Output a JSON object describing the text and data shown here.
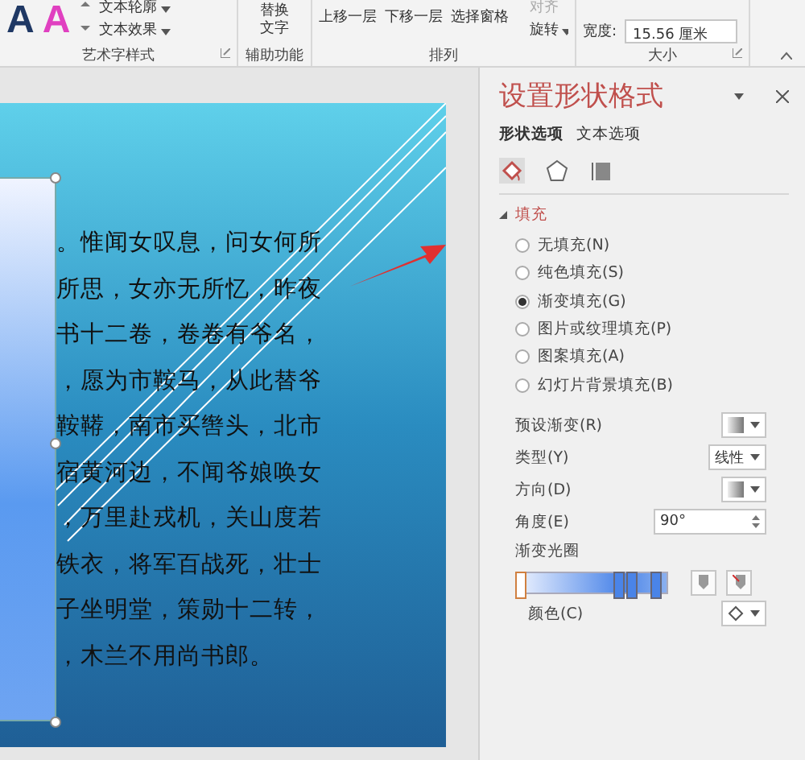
{
  "ribbon": {
    "wordart_samples": [
      {
        "glyph": "A",
        "color": "#1f3864"
      },
      {
        "glyph": "A",
        "color": "#e040c0"
      }
    ],
    "text_buttons": [
      "文本轮廓",
      "文本效果"
    ],
    "groups": [
      {
        "label": "艺术字样式",
        "launcher": true
      },
      {
        "label": "辅助功能",
        "launcher": false
      },
      {
        "label": "排列",
        "launcher": false
      },
      {
        "label": "大小",
        "launcher": true
      }
    ],
    "alt_text_button": "替换文字",
    "arrange_buttons": [
      "上移一层",
      "下移一层",
      "选择窗格"
    ],
    "align_button": "对齐",
    "rotate_button": "旋转",
    "width_label": "宽度:",
    "width_value": "15.56 厘米"
  },
  "slide": {
    "lines": [
      "。惟闻女叹息，问女何所",
      "所思，女亦无所忆，昨夜",
      "书十二卷，卷卷有爷名，",
      "，愿为市鞍马，从此替爷",
      "鞍鞯，南市买辔头，北市",
      "宿黄河边，不闻爷娘唤女",
      "，万里赴戎机，关山度若",
      "铁衣，将军百战死，壮士",
      "子坐明堂，策勋十二转，",
      "，木兰不用尚书郎。"
    ]
  },
  "pane": {
    "title": "设置形状格式",
    "tabs": [
      {
        "label": "形状选项",
        "selected": true
      },
      {
        "label": "文本选项",
        "selected": false
      }
    ],
    "icon_tabs": [
      {
        "kind": "fill",
        "selected": true
      },
      {
        "kind": "effects",
        "selected": false
      },
      {
        "kind": "size",
        "selected": false
      }
    ],
    "section": {
      "label": "填充",
      "expanded": true
    },
    "fill_options": [
      {
        "label": "无填充(N)",
        "selected": false
      },
      {
        "label": "纯色填充(S)",
        "selected": false
      },
      {
        "label": "渐变填充(G)",
        "selected": true
      },
      {
        "label": "图片或纹理填充(P)",
        "selected": false
      },
      {
        "label": "图案填充(A)",
        "selected": false
      },
      {
        "label": "幻灯片背景填充(B)",
        "selected": false
      }
    ],
    "properties": [
      {
        "kind": "swatch",
        "label": "预设渐变(R)"
      },
      {
        "kind": "select",
        "label": "类型(Y)",
        "value": "线性"
      },
      {
        "kind": "swatch",
        "label": "方向(D)"
      },
      {
        "kind": "spin",
        "label": "角度(E)",
        "value": "90°"
      }
    ],
    "stops_label": "渐变光圈",
    "stops": [
      {
        "level": 0.02,
        "selected": true
      },
      {
        "level": 0.68,
        "selected": false
      },
      {
        "level": 0.76,
        "selected": false
      },
      {
        "level": 0.92,
        "selected": false
      }
    ],
    "color_label": "颜色(C)"
  }
}
